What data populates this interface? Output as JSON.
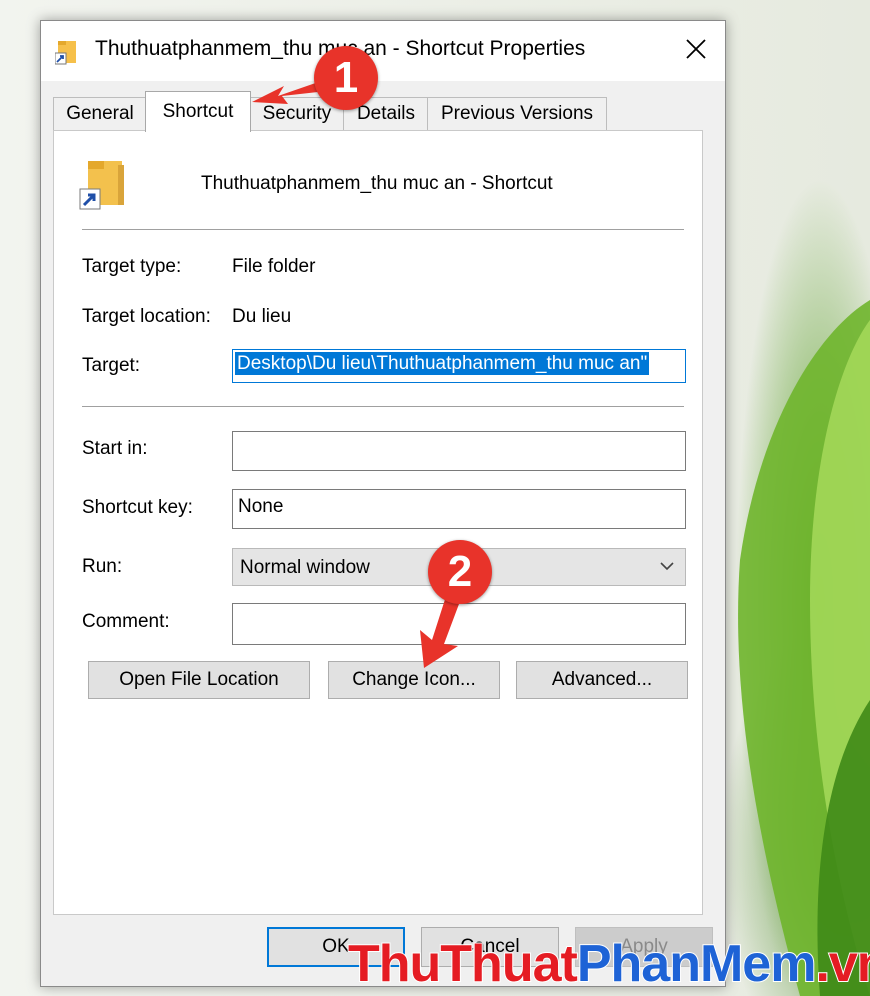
{
  "window": {
    "title": "Thuthuatphanmem_thu muc an - Shortcut Properties",
    "close_icon": "close-icon"
  },
  "tabs": [
    {
      "label": "General"
    },
    {
      "label": "Shortcut",
      "active": true
    },
    {
      "label": "Security"
    },
    {
      "label": "Details"
    },
    {
      "label": "Previous Versions"
    }
  ],
  "header": {
    "icon": "folder-shortcut-icon",
    "name": "Thuthuatphanmem_thu muc an - Shortcut"
  },
  "fields": {
    "target_type_label": "Target type:",
    "target_type_value": "File folder",
    "target_location_label": "Target location:",
    "target_location_value": "Du lieu",
    "target_label": "Target:",
    "target_value": "Desktop\\Du lieu\\Thuthuatphanmem_thu muc an\"",
    "start_in_label": "Start in:",
    "start_in_value": "",
    "shortcut_key_label": "Shortcut key:",
    "shortcut_key_value": "None",
    "run_label": "Run:",
    "run_value": "Normal window",
    "comment_label": "Comment:",
    "comment_value": ""
  },
  "buttons": {
    "open_file_location": "Open File Location",
    "change_icon": "Change Icon...",
    "advanced": "Advanced...",
    "ok": "OK",
    "cancel": "Cancel",
    "apply": "Apply"
  },
  "annotations": {
    "step1": "1",
    "step2": "2",
    "accent_color": "#e8332a"
  },
  "watermark": {
    "part1": "ThuThuat",
    "part2": "PhanMem",
    "part3": ".vn"
  }
}
